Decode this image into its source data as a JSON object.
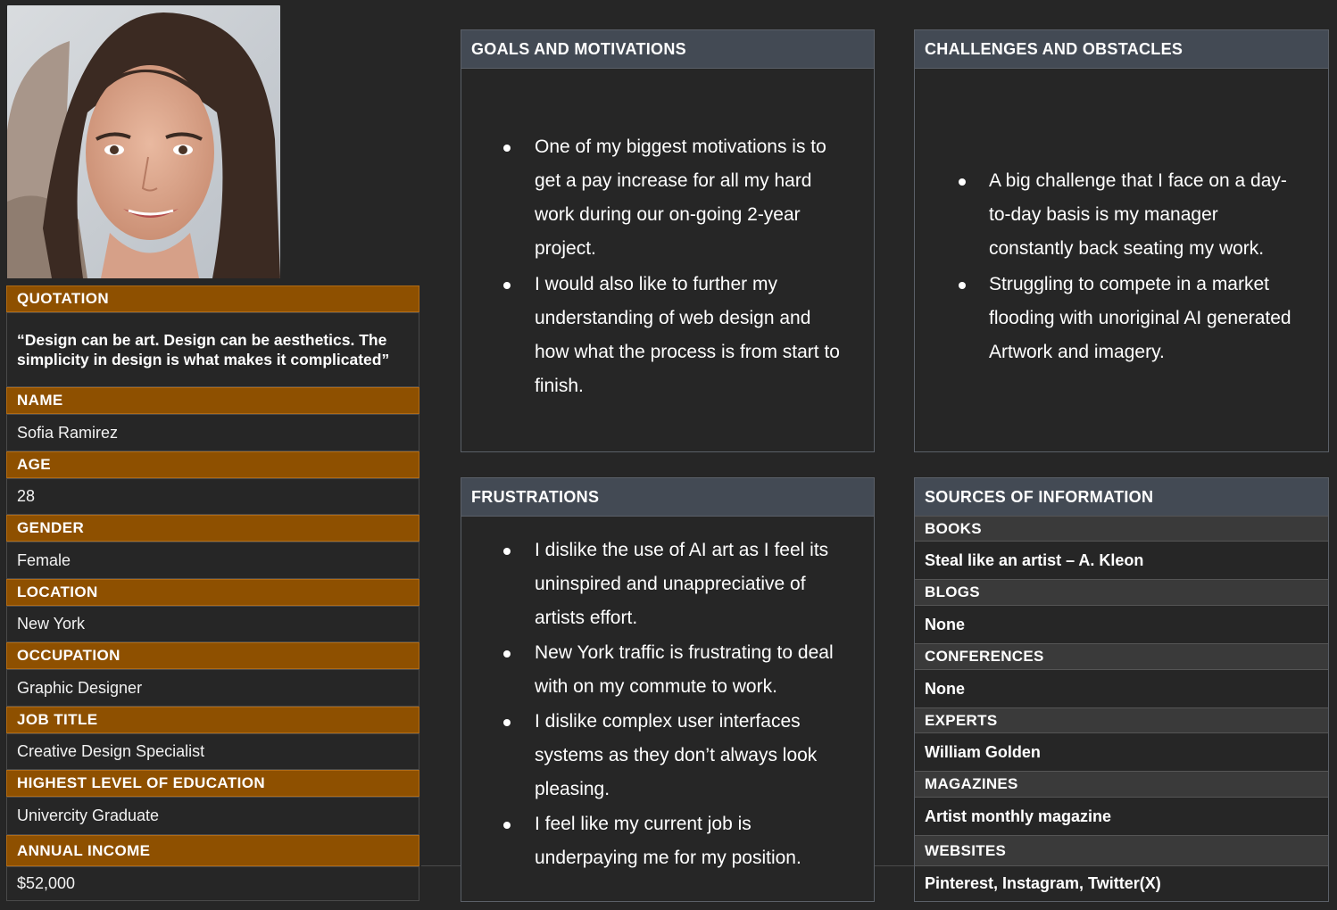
{
  "profile": {
    "quotation_label": "QUOTATION",
    "quotation": "“Design can be art. Design can be aesthetics. The simplicity in design is what makes it complicated”",
    "fields": [
      {
        "label": "NAME",
        "value": "Sofia Ramirez"
      },
      {
        "label": "AGE",
        "value": "28"
      },
      {
        "label": "GENDER",
        "value": "Female"
      },
      {
        "label": "LOCATION",
        "value": "New York"
      },
      {
        "label": "OCCUPATION",
        "value": "Graphic Designer"
      },
      {
        "label": "JOB TITLE",
        "value": "Creative Design Specialist"
      },
      {
        "label": "HIGHEST LEVEL OF EDUCATION",
        "value": "Univercity Graduate"
      },
      {
        "label": "ANNUAL INCOME",
        "value": "$52,000"
      }
    ]
  },
  "goals": {
    "title": "GOALS AND MOTIVATIONS",
    "items": [
      [
        "One of my biggest motivations is to",
        "get a pay increase for all my hard",
        "work during our on-going 2-year",
        "project."
      ],
      [
        "I would also like to further my",
        "understanding of web design and",
        "how what the process is from start to",
        "finish."
      ]
    ]
  },
  "challenges": {
    "title": "CHALLENGES AND OBSTACLES",
    "items": [
      [
        "A big challenge that I face on a day-",
        "to-day basis is my manager",
        "constantly back seating my work."
      ],
      [
        "Struggling to compete in a market",
        "flooding with unoriginal AI generated",
        "Artwork and imagery."
      ]
    ]
  },
  "frustrations": {
    "title": "FRUSTRATIONS",
    "items": [
      [
        "I dislike the use of AI art as I feel its",
        "uninspired and unappreciative of",
        "artists effort."
      ],
      [
        "New York traffic is frustrating to deal",
        "with on my commute to work."
      ],
      [
        "I dislike complex user interfaces",
        "systems as they don’t always look",
        "pleasing."
      ],
      [
        "I feel like my current job is",
        "underpaying me for my position."
      ]
    ]
  },
  "sources": {
    "title": "SOURCES OF INFORMATION",
    "rows": [
      {
        "label": "BOOKS",
        "value": "Steal like an artist – A. Kleon"
      },
      {
        "label": "BLOGS",
        "value": "None"
      },
      {
        "label": "CONFERENCES",
        "value": "None"
      },
      {
        "label": "EXPERTS",
        "value": "William Golden"
      },
      {
        "label": "MAGAZINES",
        "value": "Artist monthly magazine"
      },
      {
        "label": "WEBSITES",
        "value": "Pinterest, Instagram, Twitter(X)"
      }
    ]
  },
  "colors": {
    "background": "#262626",
    "label_bar": "#8e5000",
    "panel_header": "#434a54"
  }
}
